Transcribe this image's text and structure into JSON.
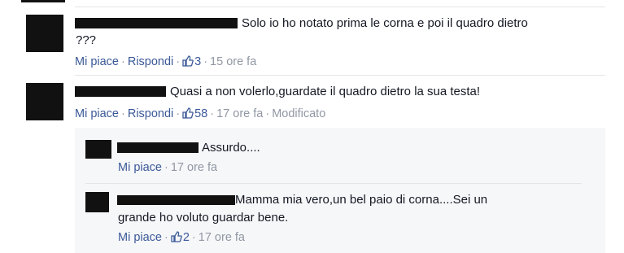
{
  "comments": [
    {
      "text_line1": "Solo io ho notato prima le corna e poi il quadro dietro",
      "text_line2": "???",
      "like_label": "Mi piace",
      "reply_label": "Rispondi",
      "like_count": "3",
      "time": "15 ore fa"
    },
    {
      "text_line1": "Quasi a non volerlo,guardate il quadro dietro la sua testa!",
      "like_label": "Mi piace",
      "reply_label": "Rispondi",
      "like_count": "58",
      "time": "17 ore fa",
      "edited": "Modificato"
    }
  ],
  "replies": [
    {
      "text_line1": "Assurdo....",
      "like_label": "Mi piace",
      "time": "17 ore fa"
    },
    {
      "text_line1": "Mamma mia vero,un bel paio di corna....Sei un",
      "text_line2": "grande ho voluto guardar bene.",
      "like_label": "Mi piace",
      "like_count": "2",
      "time": "17 ore fa"
    }
  ],
  "icons": {
    "like": "thumbs-up-icon"
  },
  "colors": {
    "link": "#3b5998",
    "meta": "#9197a3",
    "text": "#141823",
    "reply_bg": "#f6f7f9"
  }
}
